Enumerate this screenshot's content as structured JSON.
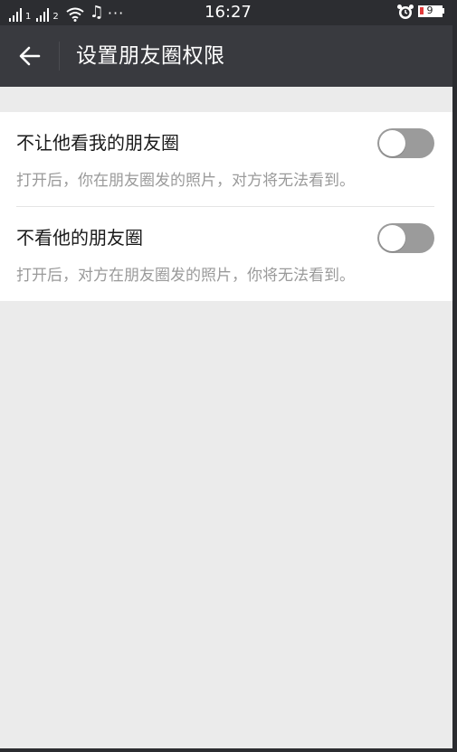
{
  "status_bar": {
    "sim1": "1",
    "sim2": "2",
    "music_icon": "♫",
    "more": "···",
    "time": "16:27",
    "battery": "9",
    "icons": [
      "signal-icon",
      "wifi-icon",
      "music-icon",
      "alarm-icon",
      "battery-icon"
    ]
  },
  "header": {
    "back_icon": "arrow-left-icon",
    "title": "设置朋友圈权限"
  },
  "settings": [
    {
      "label": "不让他看我的朋友圈",
      "description": "打开后，你在朋友圈发的照片，对方将无法看到。",
      "enabled": false
    },
    {
      "label": "不看他的朋友圈",
      "description": "打开后，对方在朋友圈发的照片，你将无法看到。",
      "enabled": false
    }
  ],
  "colors": {
    "status_bar_bg": "#2c2d31",
    "header_bg": "#393a3f",
    "page_bg": "#ebebeb",
    "toggle_off": "#9b9b9b",
    "description_text": "#9a9a9a",
    "battery_low": "#e23b3b"
  }
}
